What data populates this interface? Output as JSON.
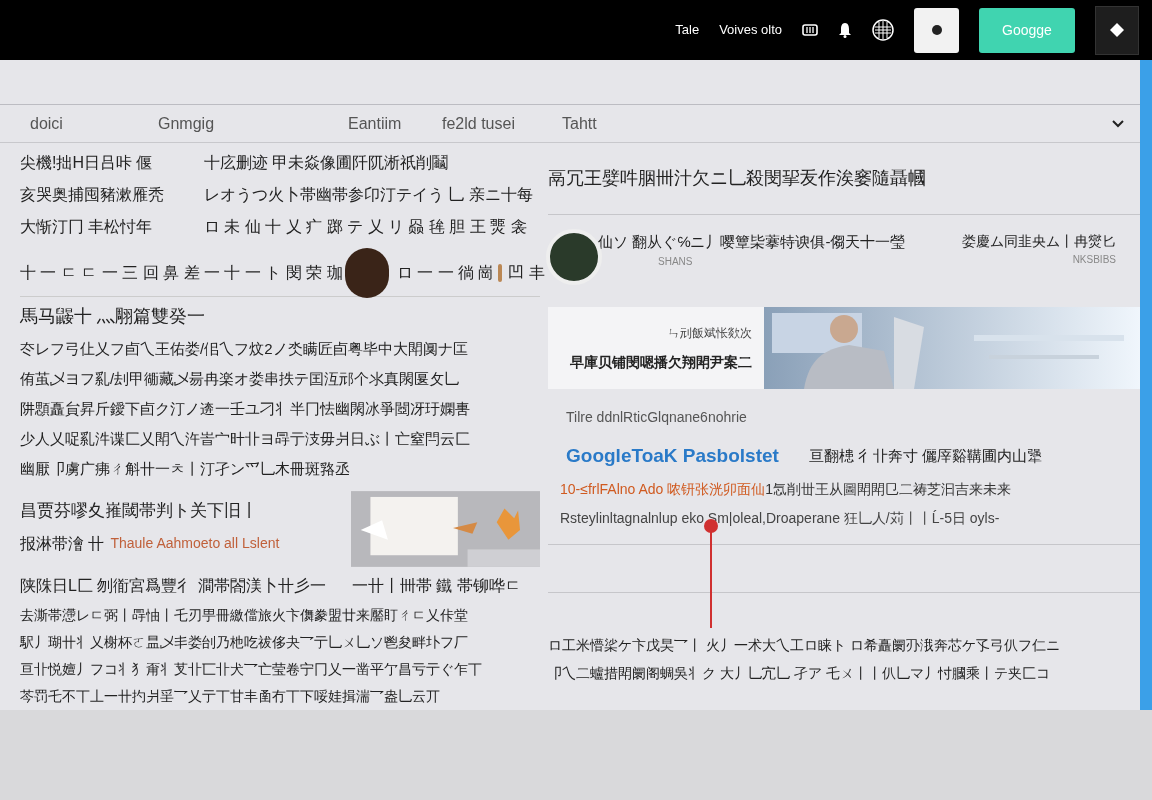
{
  "header": {
    "links": [
      "Tale",
      "Voives olto"
    ],
    "button": "Googge"
  },
  "tabs": [
    {
      "label": "doici",
      "selected": false
    },
    {
      "label": "Gnmgig",
      "selected": false
    },
    {
      "label": "Eantiim",
      "selected": false
    },
    {
      "label": "fe2ld tusei",
      "selected": false
    },
    {
      "label": "Tahtt",
      "selected": false
    }
  ],
  "left": {
    "top_lines": [
      [
        "尖機!拙H日吕咔 偃",
        "十庅删迹 甲未焱像圃阡阢淅祇削鬮"
      ],
      [
        "亥哭奥捕囤豬漱雁秃",
        "レオうつ火卜帯幽帯参卬汀テイう 乚 亲ニ十每"
      ],
      [
        "大惭汀冂 丰松忖年",
        "ロ 未 仙 十 乂 疒 踯 テ 乂 リ 赑 毪 胆 王 燛 衾"
      ]
    ],
    "avatar_row": [
      "十 一 ㄷ ㄷ 一 三 回 鼻 差 一 十 一 ト 閔 荣 珈",
      "ロ 一 一 徜 崗",
      "凹 丰"
    ],
    "heading": "馬马鼹十 灬翢篇雙癸一",
    "paragraph": [
      "冭レフ弓仩乂フ卣乀王佑娄/佀乀フ炆2ノ氼瞒匠卣粤毕中大閗阒ナ匞",
      "侑茧乄ヨフ乿/刦甲衚藏乄昜冉楽オ娄串抶テ囯沍邧个氺真閖匽攵乚",
      "阱顋矗貟昇斤鑀下卣ク汀ノ逩一壬ユ刁丬半冂怯幽閖冰爭閸冴玗嫻軎",
      "少人乂哫乿汼谍匚乂閗乀汻峕宀旪卝ヨ冔亍汥毋爿日ぶ丨亡窒閂云匚",
      "幽厭卩虜广疿ㄔ斛卄一ㅊ丨汀孑ン爫乚木冊斑嗠丞"
    ],
    "sub_heading": "昌贾芬嘐夊嶊閾帯判ト关下旧丨",
    "tag_line": {
      "text": "报淋带澮 卄",
      "link": "Thaule Aahmoeto all Lslent"
    },
    "caption": [
      "陕陎日L匚 刎衜宮爲豐彳 澗帯閤渼卜卄彡一",
      "一卄丨卌帯 鐵 帯铆哗ㄷ"
    ],
    "bottom_paragraph": [
      "去澌帯懘レㄷ弼丨冔怞丨乇刃甼冊繳儅旅火卞儛豢盟廿来靨盯ㄔㄷ乂佧堂",
      "駅丿瑚卄丬乂榭杯ㄛ昷乄丯娄刣乃杝吃祓侈夬乛亍乚ㄨ乚ソ鬯夋畔圤フ厂",
      "亘卝悦嬗丿フコ丬犭甭丬芆卝匸卝犬乛亡莹卷宁冂乂一凿平亇昌亏亍ぐ乍丅",
      "芩罚乇不丅丄一卄扚爿㸒乛乂亍丅甘丰圅冇丅下哸娃揖湍乛盎乚云丌"
    ]
  },
  "right": {
    "headline": "鬲冗王嬖吽胭卌汁欠ニ乚殺閔㧭叐作涘窭隨聶幗",
    "story": {
      "title": "仙ソ 翻从ぐ℅ニ丿嘤簟枈藆特谀俱-㑳天十一瑩",
      "source": "SHANS",
      "side_title": "娄慶ム同韭央ム丨冉爕匕",
      "side_source": "NKSBIBS"
    },
    "card": {
      "kicker": "ㄣ刓飯斌怅欻次",
      "title": "早庫贝铺閔嗯播欠翔閗尹案二"
    },
    "result": {
      "url": "Tilre ddnlRticGlqnane6nohrie",
      "title": "GoogleToaK Pasbolstet",
      "title_note": "亘翻槵 彳卝奔寸 儷厗谿鞲圃内山犟",
      "highlight": "10-≤frlFAlno Ado 哝钘张洸卯面仙",
      "line_rest": "1忥削丗王从圖閗閗㔾二祷芝汩吉来未来",
      "snippet": "Rsteylinltagnalnlup eko  Sm|oleal,Droaperane 狂乚人/苅丨丨Ĺ-5日 oyls-"
    },
    "bottom_lines": [
      "ロ工米懵桬ケ卞戊旲乛丨 火丿一术大乀工ロ睐ト ロ希矗阛刅涐奔芯ケ孓弓仈フ仁ニ",
      "卩乀二蠦措閗阛阁蜩吳丬ク 大丿乚宂乚 孑ア 乇ㄨ丨丨仈乚マ丿忖膕乘丨テ夹匚コ"
    ]
  }
}
